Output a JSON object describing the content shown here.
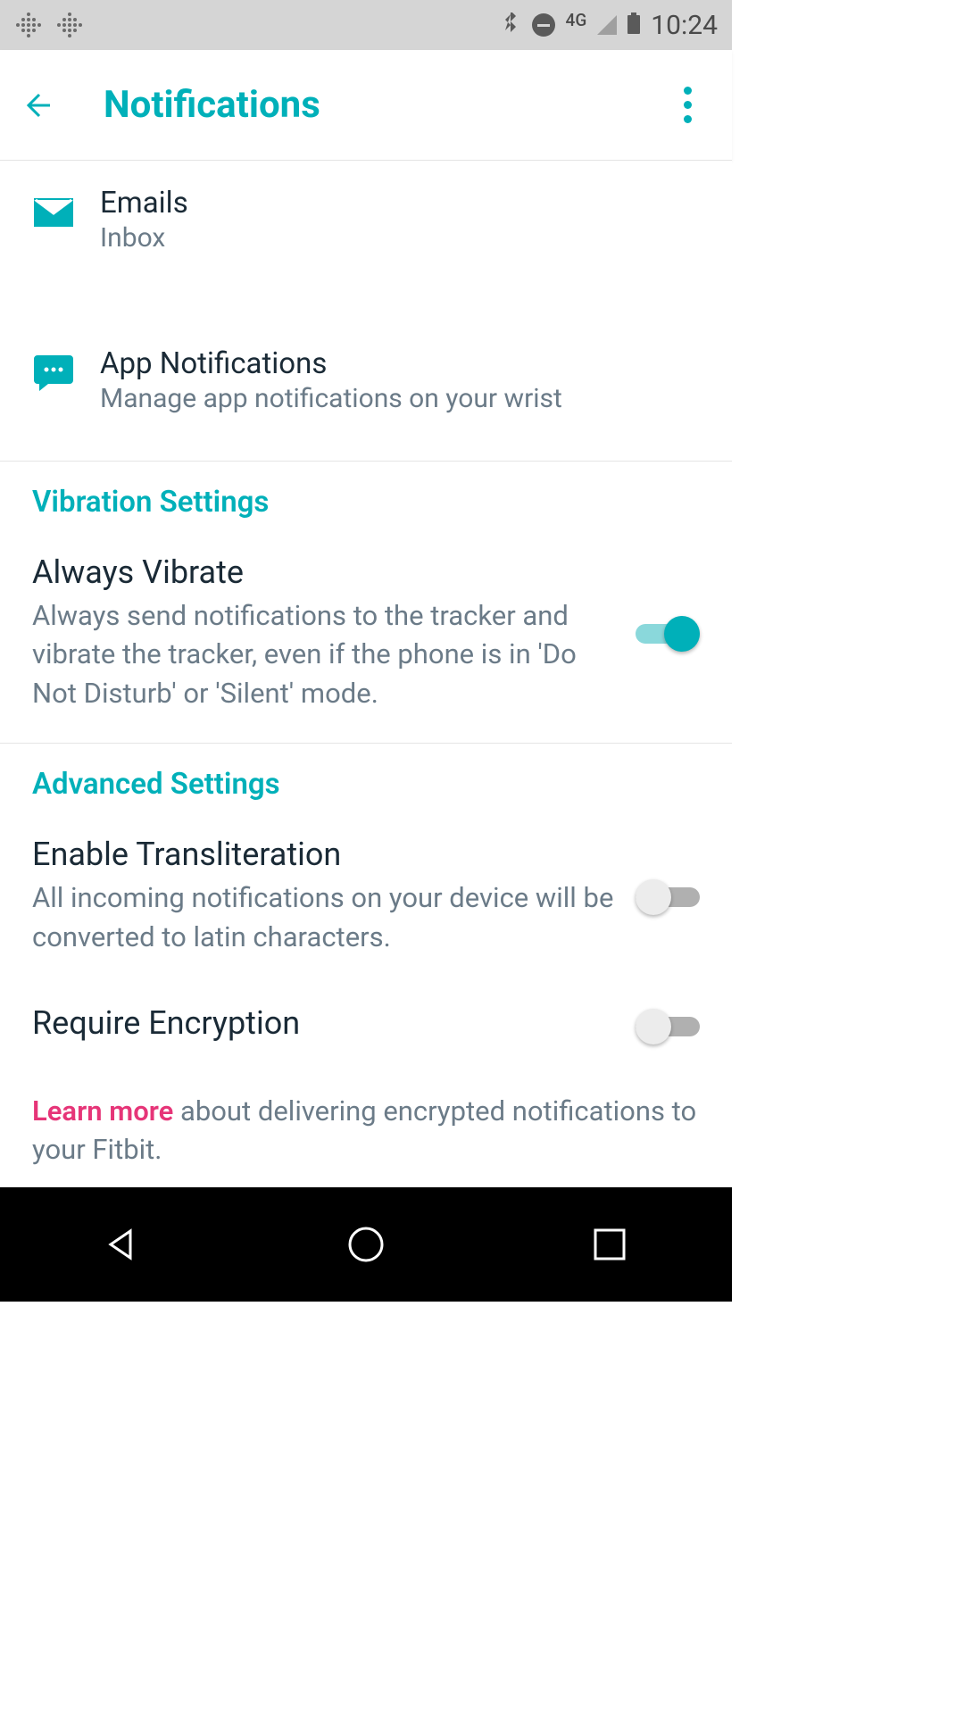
{
  "status": {
    "network": "4G",
    "time": "10:24"
  },
  "appbar": {
    "title": "Notifications"
  },
  "items": {
    "emails": {
      "title": "Emails",
      "subtitle": "Inbox"
    },
    "appnotif": {
      "title": "App Notifications",
      "subtitle": "Manage app notifications on your wrist"
    }
  },
  "vibration": {
    "header": "Vibration Settings",
    "always": {
      "title": "Always Vibrate",
      "subtitle": "Always send notifications to the tracker and vibrate the tracker, even if the phone is in 'Do Not Disturb' or 'Silent' mode.",
      "on": true
    }
  },
  "advanced": {
    "header": "Advanced Settings",
    "translit": {
      "title": "Enable Transliteration",
      "subtitle": "All incoming notifications on your device will be converted to latin characters.",
      "on": false
    },
    "encrypt": {
      "title": "Require Encryption",
      "on": false
    },
    "learn": {
      "link": "Learn more",
      "rest": " about delivering encrypted notifications to your Fitbit."
    }
  }
}
